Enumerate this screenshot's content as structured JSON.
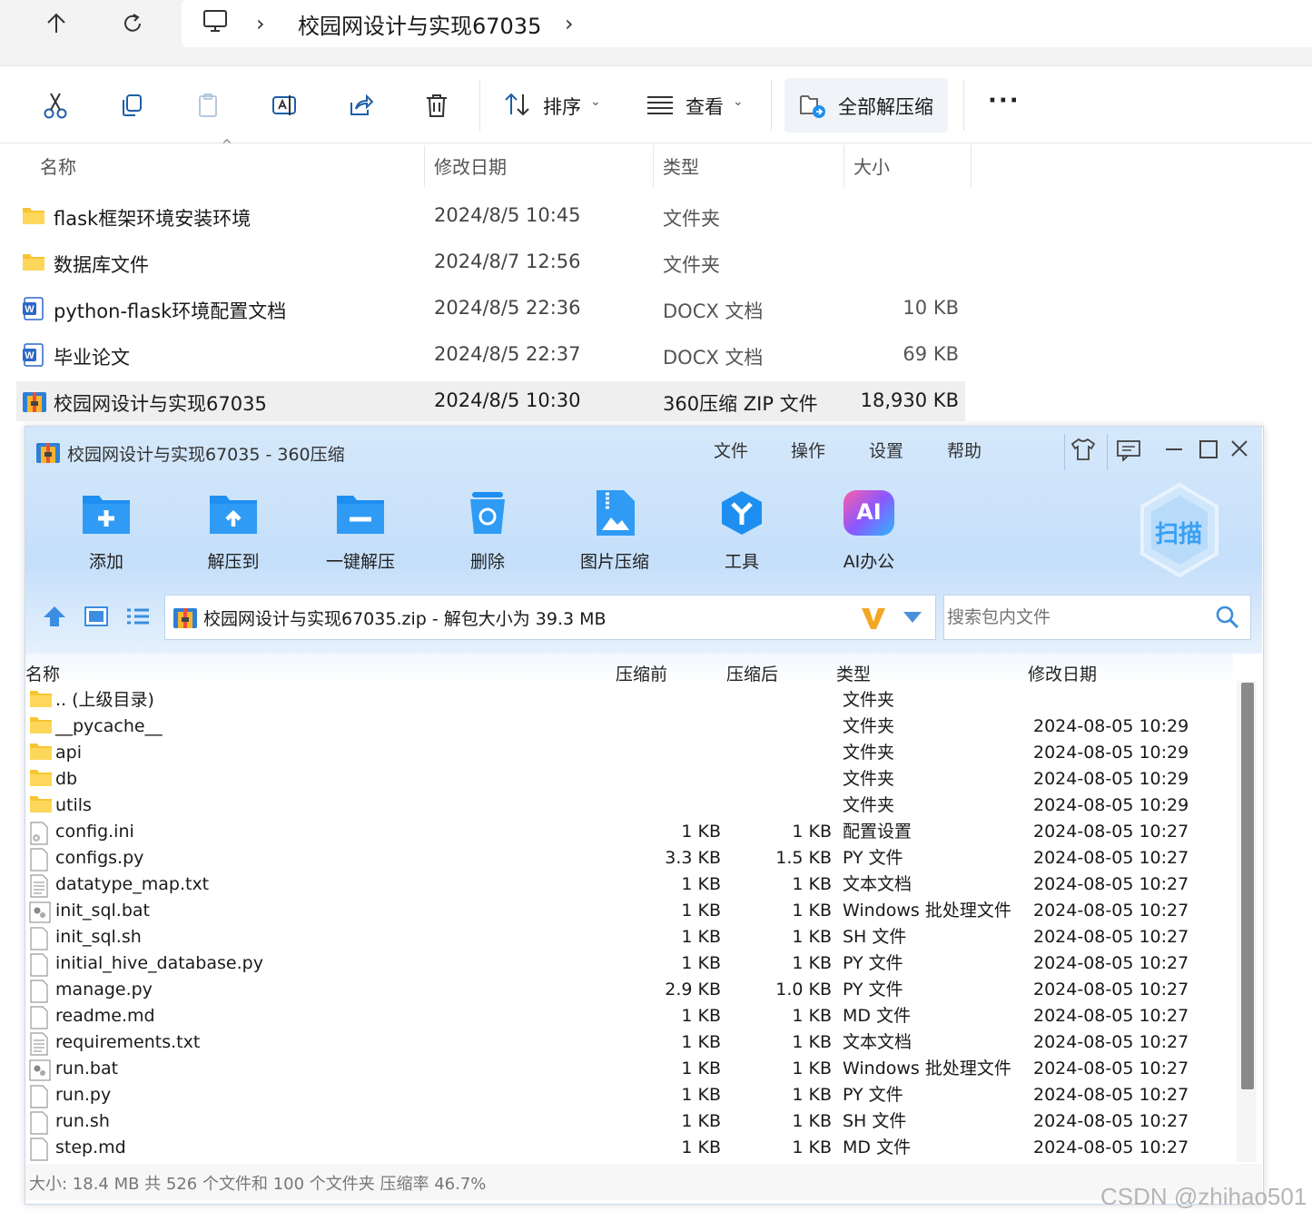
{
  "explorer": {
    "breadcrumb": {
      "current_folder": "校园网设计与实现67035"
    },
    "toolbar": {
      "sort_label": "排序",
      "view_label": "查看",
      "extract_all_label": "全部解压缩"
    },
    "columns": {
      "name": "名称",
      "modified": "修改日期",
      "type": "类型",
      "size": "大小"
    },
    "files": [
      {
        "name": "flask框架环境安装环境",
        "modified": "2024/8/5 10:45",
        "type": "文件夹",
        "size": "",
        "icon": "folder-icon"
      },
      {
        "name": "数据库文件",
        "modified": "2024/8/7 12:56",
        "type": "文件夹",
        "size": "",
        "icon": "folder-icon"
      },
      {
        "name": "python-flask环境配置文档",
        "modified": "2024/8/5 22:36",
        "type": "DOCX 文档",
        "size": "10 KB",
        "icon": "word-doc-icon"
      },
      {
        "name": "毕业论文",
        "modified": "2024/8/5 22:37",
        "type": "DOCX 文档",
        "size": "69 KB",
        "icon": "word-doc-icon"
      },
      {
        "name": "校园网设计与实现67035",
        "modified": "2024/8/5 10:30",
        "type": "360压缩 ZIP 文件",
        "size": "18,930 KB",
        "icon": "zip-archive-icon"
      }
    ]
  },
  "zip_window": {
    "title": "校园网设计与实现67035 - 360压缩",
    "menu": [
      "文件",
      "操作",
      "设置",
      "帮助"
    ],
    "actions": [
      "添加",
      "解压到",
      "一键解压",
      "删除",
      "图片压缩",
      "工具",
      "AI办公"
    ],
    "scan_label": "扫描",
    "ai_badge": "AI",
    "path_text": "校园网设计与实现67035.zip - 解包大小为 39.3 MB",
    "search_placeholder": "搜索包内文件",
    "columns": {
      "name": "名称",
      "before": "压缩前",
      "after": "压缩后",
      "type": "类型",
      "modified": "修改日期"
    },
    "files": [
      {
        "name": ".. (上级目录)",
        "before": "",
        "after": "",
        "type": "文件夹",
        "modified": "",
        "icon": "folder-icon"
      },
      {
        "name": "__pycache__",
        "before": "",
        "after": "",
        "type": "文件夹",
        "modified": "2024-08-05 10:29",
        "icon": "folder-icon"
      },
      {
        "name": "api",
        "before": "",
        "after": "",
        "type": "文件夹",
        "modified": "2024-08-05 10:29",
        "icon": "folder-icon"
      },
      {
        "name": "db",
        "before": "",
        "after": "",
        "type": "文件夹",
        "modified": "2024-08-05 10:29",
        "icon": "folder-icon"
      },
      {
        "name": "utils",
        "before": "",
        "after": "",
        "type": "文件夹",
        "modified": "2024-08-05 10:29",
        "icon": "folder-icon"
      },
      {
        "name": "config.ini",
        "before": "1 KB",
        "after": "1 KB",
        "type": "配置设置",
        "modified": "2024-08-05 10:27",
        "icon": "settings-file-icon"
      },
      {
        "name": "configs.py",
        "before": "3.3 KB",
        "after": "1.5 KB",
        "type": "PY 文件",
        "modified": "2024-08-05 10:27",
        "icon": "file-icon"
      },
      {
        "name": "datatype_map.txt",
        "before": "1 KB",
        "after": "1 KB",
        "type": "文本文档",
        "modified": "2024-08-05 10:27",
        "icon": "text-file-icon"
      },
      {
        "name": "init_sql.bat",
        "before": "1 KB",
        "after": "1 KB",
        "type": "Windows 批处理文件",
        "modified": "2024-08-05 10:27",
        "icon": "batch-file-icon"
      },
      {
        "name": "init_sql.sh",
        "before": "1 KB",
        "after": "1 KB",
        "type": "SH 文件",
        "modified": "2024-08-05 10:27",
        "icon": "file-icon"
      },
      {
        "name": "initial_hive_database.py",
        "before": "1 KB",
        "after": "1 KB",
        "type": "PY 文件",
        "modified": "2024-08-05 10:27",
        "icon": "file-icon"
      },
      {
        "name": "manage.py",
        "before": "2.9 KB",
        "after": "1.0 KB",
        "type": "PY 文件",
        "modified": "2024-08-05 10:27",
        "icon": "file-icon"
      },
      {
        "name": "readme.md",
        "before": "1 KB",
        "after": "1 KB",
        "type": "MD 文件",
        "modified": "2024-08-05 10:27",
        "icon": "file-icon"
      },
      {
        "name": "requirements.txt",
        "before": "1 KB",
        "after": "1 KB",
        "type": "文本文档",
        "modified": "2024-08-05 10:27",
        "icon": "text-file-icon"
      },
      {
        "name": "run.bat",
        "before": "1 KB",
        "after": "1 KB",
        "type": "Windows 批处理文件",
        "modified": "2024-08-05 10:27",
        "icon": "batch-file-icon"
      },
      {
        "name": "run.py",
        "before": "1 KB",
        "after": "1 KB",
        "type": "PY 文件",
        "modified": "2024-08-05 10:27",
        "icon": "file-icon"
      },
      {
        "name": "run.sh",
        "before": "1 KB",
        "after": "1 KB",
        "type": "SH 文件",
        "modified": "2024-08-05 10:27",
        "icon": "file-icon"
      },
      {
        "name": "step.md",
        "before": "1 KB",
        "after": "1 KB",
        "type": "MD 文件",
        "modified": "2024-08-05 10:27",
        "icon": "file-icon"
      }
    ],
    "status": "大小: 18.4 MB 共 526 个文件和 100 个文件夹 压缩率 46.7%"
  },
  "watermark": "CSDN @zhihao501",
  "colors": {
    "folder": "#f7c531",
    "accent_blue": "#1e8ff0",
    "word_blue": "#2b67c9",
    "zip_bg": "#d2e6fb"
  }
}
